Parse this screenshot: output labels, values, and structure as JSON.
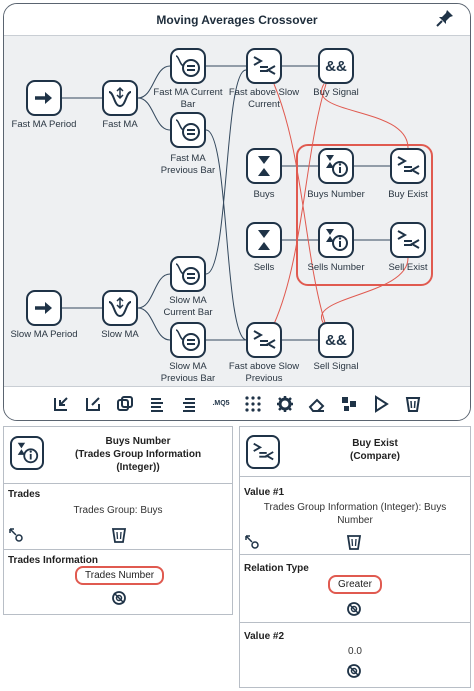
{
  "editor": {
    "title": "Moving Averages Crossover",
    "nodes": {
      "fast_ma_period": "Fast MA Period",
      "fast_ma": "Fast MA",
      "fast_ma_current_bar_1": "Fast MA Current",
      "fast_ma_current_bar_2": "Bar",
      "fast_ma_previous_bar_1": "Fast MA",
      "fast_ma_previous_bar_2": "Previous Bar",
      "fast_above_slow_current_1": "Fast above Slow",
      "fast_above_slow_current_2": "Current",
      "buy_signal": "Buy Signal",
      "buys": "Buys",
      "buys_number": "Buys Number",
      "buy_exist": "Buy Exist",
      "sells": "Sells",
      "sells_number": "Sells Number",
      "sell_exist": "Sell Exist",
      "slow_ma_period": "Slow MA Period",
      "slow_ma": "Slow MA",
      "slow_ma_current_bar_1": "Slow MA",
      "slow_ma_current_bar_2": "Current Bar",
      "slow_ma_previous_bar_1": "Slow MA",
      "slow_ma_previous_bar_2": "Previous Bar",
      "fast_above_slow_previous_1": "Fast above Slow",
      "fast_above_slow_previous_2": "Previous",
      "sell_signal": "Sell Signal",
      "and_symbol": "&&"
    },
    "toolbar_icons": [
      "import-icon",
      "edit-icon",
      "copy-icon",
      "align-left-icon",
      "align-right-icon",
      "mq5-export-icon",
      "grid-icon",
      "gear-icon",
      "eraser-icon",
      "layout-icon",
      "play-icon",
      "delete-icon"
    ],
    "toolbar_mq5_label": ".MQ5"
  },
  "left_panel": {
    "title_line1": "Buys Number",
    "title_line2": "(Trades Group Information",
    "title_line3": "(Integer))",
    "trades_label": "Trades",
    "trades_value": "Trades Group: Buys",
    "trades_info_label": "Trades Information",
    "trades_info_value": "Trades Number"
  },
  "right_panel": {
    "title_line1": "Buy Exist",
    "title_line2": "(Compare)",
    "value1_label": "Value #1",
    "value1_line1": "Trades Group Information (Integer): Buys",
    "value1_line2": "Number",
    "relation_label": "Relation Type",
    "relation_value": "Greater",
    "value2_label": "Value #2",
    "value2_value": "0.0"
  },
  "colors": {
    "accent_red": "#e05a50",
    "node_border": "#1f3347",
    "wire_dark": "#34495e",
    "panel_bg": "#eef0f2"
  }
}
